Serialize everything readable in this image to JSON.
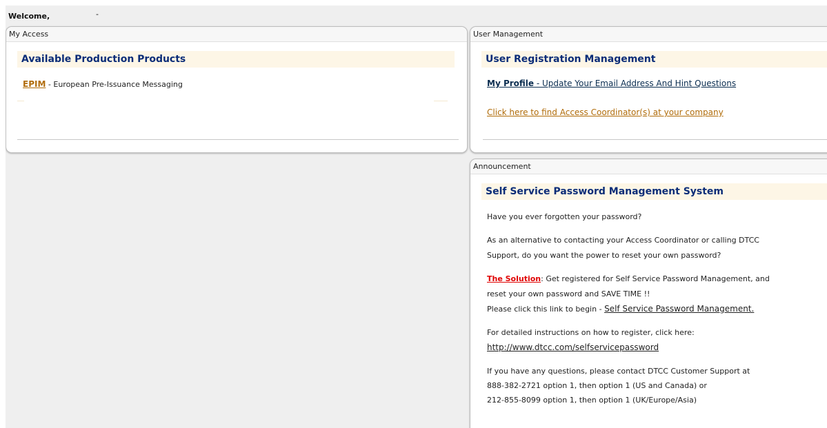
{
  "header": {
    "welcome": "Welcome,",
    "user_marker": "-"
  },
  "my_access": {
    "panel_title": "My Access",
    "section_title": "Available Production Products",
    "product": {
      "code": "EPIM",
      "separator": " - ",
      "description": "European Pre-Issuance Messaging"
    }
  },
  "user_management": {
    "panel_title": "User Management",
    "section_title": "User Registration Management",
    "profile_link_strong": "My Profile",
    "profile_link_rest": " - Update Your Email Address And Hint Questions",
    "coordinator_link": "Click here to find Access Coordinator(s) at your company"
  },
  "announcement": {
    "panel_title": "Announcement",
    "section_title": "Self Service Password Management System",
    "line1": "Have you ever forgotten your password?",
    "line2": "As an alternative to contacting your Access Coordinator or calling DTCC",
    "line3": "Support, do you want the power to reset your own password?",
    "solution_label": "The Solution",
    "solution_text": ": Get registered for Self Service Password Management, and",
    "line5": "reset your own password and SAVE TIME !!",
    "begin_text": "Please click this link to begin - ",
    "begin_link": "Self Service Password Management.",
    "instructions": "For detailed instructions on how to register, click here:",
    "instructions_link": "http://www.dtcc.com/selfservicepassword",
    "contact_line1": "If you have any questions, please contact DTCC Customer Support at",
    "contact_line2": "888-382-2721 option 1, then option 1 (US and Canada) or",
    "contact_line3": "212-855-8099 option 1, then option 1 (UK/Europe/Asia)"
  },
  "colors": {
    "title_blue": "#0b2d78",
    "link_gold": "#b06c0a",
    "solution_red": "#e00000",
    "title_band": "#fdf6e6",
    "page_bg": "#efefef"
  }
}
